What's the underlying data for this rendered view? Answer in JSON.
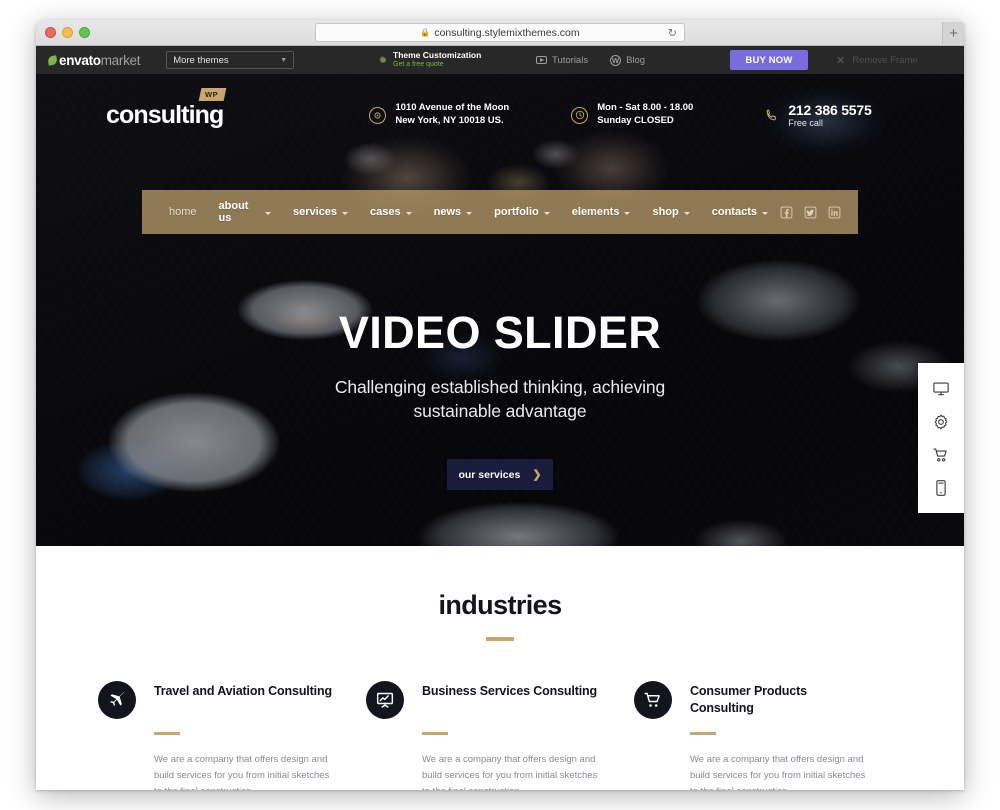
{
  "browser": {
    "url": "consulting.stylemixthemes.com",
    "lock_icon": "lock-icon",
    "reload_icon": "reload-icon",
    "newtab_label": "+"
  },
  "envato_bar": {
    "logo_part1": "envato",
    "logo_part2": "market",
    "theme_select_value": "More themes",
    "theme_customization_title": "Theme Customization",
    "theme_customization_sub": "Get a free quote",
    "links": [
      {
        "label": "Tutorials",
        "icon": "youtube-icon"
      },
      {
        "label": "Blog",
        "icon": "wordpress-icon"
      }
    ],
    "buy_now_label": "BUY NOW",
    "remove_frame_label": "Remove Frame",
    "accent_purple": "#7a6ce0",
    "accent_green": "#7fb04a"
  },
  "site_header": {
    "brand": "consulting",
    "brand_badge": "WP",
    "address_line1": "1010 Avenue of the Moon",
    "address_line2": "New York, NY 10018 US.",
    "hours_line1": "Mon - Sat 8.00 - 18.00",
    "hours_line2": "Sunday CLOSED",
    "phone": "212 386 5575",
    "phone_sub": "Free call"
  },
  "nav": {
    "items": [
      {
        "label": "home",
        "has_caret": false
      },
      {
        "label": "about us",
        "has_caret": true
      },
      {
        "label": "services",
        "has_caret": true
      },
      {
        "label": "cases",
        "has_caret": true
      },
      {
        "label": "news",
        "has_caret": true
      },
      {
        "label": "portfolio",
        "has_caret": true
      },
      {
        "label": "elements",
        "has_caret": true
      },
      {
        "label": "shop",
        "has_caret": true
      },
      {
        "label": "contacts",
        "has_caret": true
      }
    ],
    "social": [
      "facebook-icon",
      "twitter-icon",
      "linkedin-icon"
    ],
    "bar_color": "#b29668"
  },
  "hero": {
    "title": "VIDEO SLIDER",
    "subtitle_line1": "Challenging established thinking, achieving",
    "subtitle_line2": "sustainable advantage",
    "button_label": "our services",
    "button_arrow": "❯",
    "button_color": "#1a1c3c",
    "arrow_color": "#c9a66b"
  },
  "side_panel": {
    "items": [
      {
        "icon": "monitor-icon"
      },
      {
        "icon": "gear-icon"
      },
      {
        "icon": "cart-icon"
      },
      {
        "icon": "mobile-icon"
      }
    ]
  },
  "industries": {
    "title": "industries",
    "accent": "#c9a66b",
    "cards": [
      {
        "icon": "airplane-icon",
        "title": "Travel and Aviation Consulting",
        "desc": "We are a company that offers design and build services for you from initial sketches to the final construction."
      },
      {
        "icon": "presentation-chart-icon",
        "title": "Business Services Consulting",
        "desc": "We are a company that offers design and build services for you from initial sketches to the final construction."
      },
      {
        "icon": "shopping-cart-icon",
        "title": "Consumer Products Consulting",
        "desc": "We are a company that offers design and build services for you from initial sketches to the final construction."
      }
    ]
  }
}
